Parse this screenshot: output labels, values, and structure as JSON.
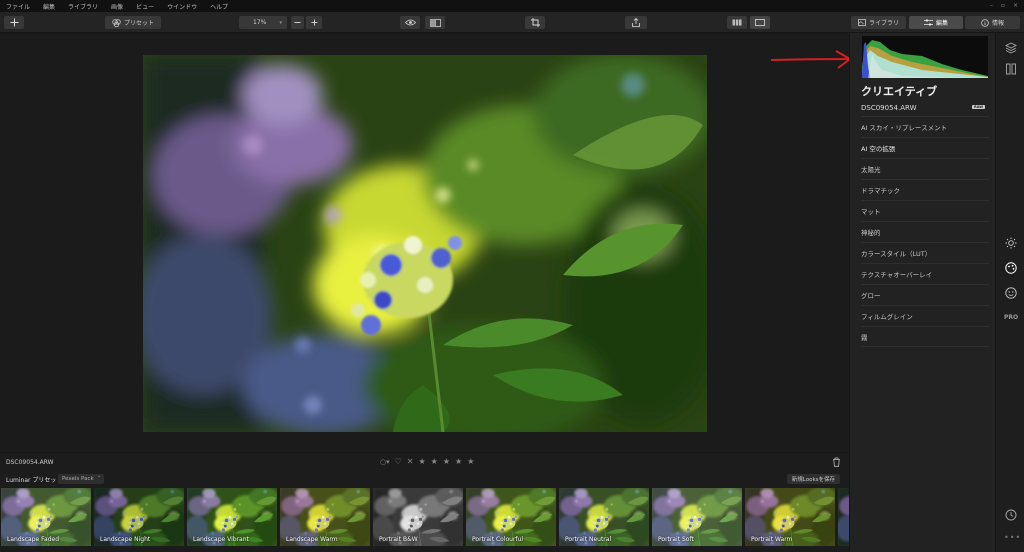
{
  "menu": [
    "ファイル",
    "編集",
    "ライブラリ",
    "画像",
    "ビュー",
    "ウインドウ",
    "ヘルプ"
  ],
  "toolbar": {
    "add_icon": "plus-icon",
    "presets_label": "プリセット",
    "zoom_value": "17%",
    "library_tab": "ライブラリ",
    "edit_tab": "編集",
    "info_tab": "情報"
  },
  "panel": {
    "title": "クリエイティブ",
    "filename": "DSC09054.ARW",
    "raw_badge": "RAW",
    "items": [
      "AI スカイ・リプレースメント",
      "AI 空の拡張",
      "太陽光",
      "ドラマチック",
      "マット",
      "神秘的",
      "カラースタイル（LUT）",
      "テクスチャオーバーレイ",
      "グロー",
      "フィルムグレイン",
      "霧"
    ],
    "rail_pro": "PRO"
  },
  "infobar": {
    "filename": "DSC09054.ARW"
  },
  "presets": {
    "header_label": "Luminar プリセット",
    "pack": "Pexels Pack",
    "save_label": "新規Looksを保存",
    "thumbs": [
      "Landscape Faded",
      "Landscape Night",
      "Landscape Vibrant",
      "Landscape Warm",
      "Portrait B&W",
      "Portrait Colourful",
      "Portrait Neutral",
      "Portrait Soft",
      "Portrait Warm"
    ]
  },
  "colors": {
    "accent_arrow": "#d42020",
    "panel_bg": "#222222",
    "app_bg": "#1b1b1b"
  }
}
